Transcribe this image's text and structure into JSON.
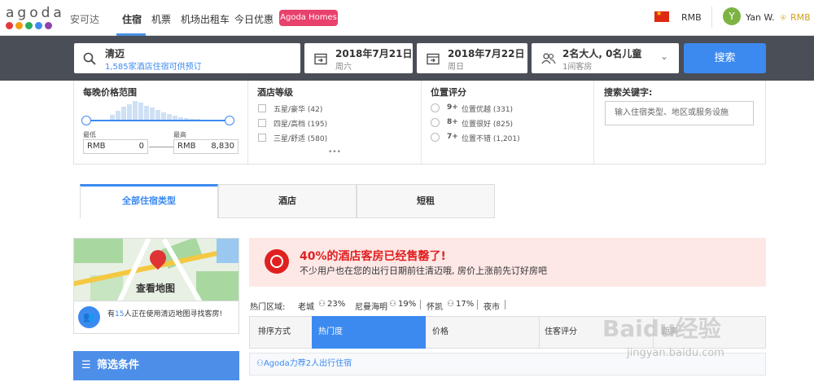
{
  "topnav": {
    "logo": "agoda",
    "logo_cn": "安可达",
    "tabs": [
      "住宿",
      "机票",
      "机场出租车",
      "今日优惠"
    ],
    "homes_button": "Agoda Homes",
    "currency": "RMB",
    "avatar_letter": "Y",
    "user_name": "Yan W.",
    "points": "RMB"
  },
  "search": {
    "destination": "清迈",
    "destination_sub": "1,585家酒店住宿可供预订",
    "checkin_date": "2018年7月21日",
    "checkin_day": "周六",
    "checkout_date": "2018年7月22日",
    "checkout_day": "周日",
    "guests": "2名大人, 0名儿童",
    "rooms": "1间客房",
    "search_button": "搜索"
  },
  "filters": {
    "price": {
      "title": "每晚价格范围",
      "min_label": "最低",
      "max_label": "最高",
      "currency": "RMB",
      "min_value": "0",
      "max_value": "8,830"
    },
    "stars": {
      "title": "酒店等级",
      "options": [
        "五星/豪华 (42)",
        "四星/高档 (195)",
        "三星/舒适 (580)"
      ],
      "more": "•••"
    },
    "rating": {
      "title": "位置评分",
      "options": [
        {
          "score": "9+",
          "label": "位置优越 (331)"
        },
        {
          "score": "8+",
          "label": "位置很好 (825)"
        },
        {
          "score": "7+",
          "label": "位置不错 (1,201)"
        }
      ]
    },
    "keyword": {
      "title": "搜索关键字:",
      "placeholder": "输入住宿类型、地区或服务设施"
    }
  },
  "property_tabs": [
    "全部住宿类型",
    "酒店",
    "短租"
  ],
  "map": {
    "label": "查看地图",
    "users_prefix": "有",
    "users_count": "15",
    "users_suffix": "人正在使用清迈地图寻找客房!"
  },
  "filter_conditions": "筛选条件",
  "alert": {
    "title": "40%的酒店客房已经售罄了!",
    "subtitle": "不少用户也在您的出行日期前往清迈哦, 房价上涨前先订好房吧"
  },
  "hot_districts": {
    "label": "热门区域:",
    "items": [
      {
        "name": "老城",
        "pct": "23%"
      },
      {
        "name": "尼曼海明",
        "pct": "19%"
      },
      {
        "name": "怀凯",
        "pct": "17%"
      },
      {
        "name": "夜市",
        "pct": ""
      }
    ]
  },
  "sort": {
    "label": "排序方式",
    "options": [
      "热门度",
      "价格",
      "住客评分",
      "距离"
    ]
  },
  "promo": "Agoda力荐2人出行住宿",
  "watermark": {
    "main": "Baidu经验",
    "sub": "jingyan.baidu.com"
  },
  "colors": {
    "accent": "#3c8af0",
    "alert": "#e02020",
    "homes": "#e8416c"
  }
}
